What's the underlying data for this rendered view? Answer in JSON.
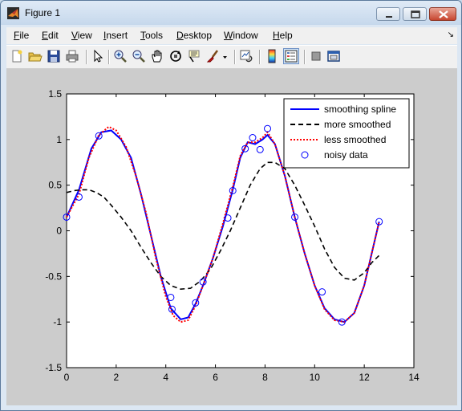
{
  "window": {
    "title": "Figure 1"
  },
  "menu": {
    "items": [
      {
        "pre": "",
        "key": "F",
        "rest": "ile"
      },
      {
        "pre": "",
        "key": "E",
        "rest": "dit"
      },
      {
        "pre": "",
        "key": "V",
        "rest": "iew"
      },
      {
        "pre": "",
        "key": "I",
        "rest": "nsert"
      },
      {
        "pre": "",
        "key": "T",
        "rest": "ools"
      },
      {
        "pre": "",
        "key": "D",
        "rest": "esktop"
      },
      {
        "pre": "",
        "key": "W",
        "rest": "indow"
      },
      {
        "pre": "",
        "key": "H",
        "rest": "elp"
      }
    ]
  },
  "toolbar": {
    "icons": [
      "new-figure-icon",
      "open-file-icon",
      "save-icon",
      "print-icon",
      "edit-plot-icon",
      "zoom-in-icon",
      "zoom-out-icon",
      "pan-icon",
      "rotate-3d-icon",
      "data-cursor-icon",
      "brush-icon",
      "brush-dropdown-icon",
      "link-plot-icon",
      "insert-colorbar-icon",
      "insert-legend-icon",
      "hide-plot-tools-icon",
      "show-plot-tools-icon"
    ]
  },
  "chart_data": {
    "type": "line",
    "title": "",
    "xlabel": "",
    "ylabel": "",
    "xlim": [
      0,
      14
    ],
    "ylim": [
      -1.5,
      1.5
    ],
    "xticks": [
      "0",
      "2",
      "4",
      "6",
      "8",
      "10",
      "12",
      "14"
    ],
    "yticks": [
      "-1.5",
      "-1",
      "-0.5",
      "0",
      "0.5",
      "1",
      "1.5"
    ],
    "grid": false,
    "legend_position": "top-right",
    "series": [
      {
        "name": "smoothing spline",
        "style": "solid",
        "color": "#0000ff",
        "x": [
          0,
          0.5,
          1,
          1.4,
          1.8,
          2.2,
          2.6,
          3.0,
          3.4,
          3.8,
          4.2,
          4.6,
          4.9,
          5.2,
          5.5,
          5.9,
          6.3,
          6.7,
          7.0,
          7.3,
          7.6,
          7.9,
          8.1,
          8.4,
          8.8,
          9.2,
          9.6,
          10.0,
          10.4,
          10.8,
          11.2,
          11.6,
          12.0,
          12.3,
          12.6
        ],
        "y": [
          0.15,
          0.45,
          0.9,
          1.08,
          1.1,
          1.0,
          0.8,
          0.4,
          -0.05,
          -0.5,
          -0.85,
          -0.97,
          -0.95,
          -0.8,
          -0.6,
          -0.3,
          0.05,
          0.45,
          0.8,
          0.97,
          0.95,
          1.0,
          1.05,
          0.95,
          0.6,
          0.15,
          -0.25,
          -0.6,
          -0.85,
          -0.97,
          -1.0,
          -0.9,
          -0.6,
          -0.25,
          0.1
        ]
      },
      {
        "name": "more smoothed",
        "style": "dashed",
        "color": "#000000",
        "x": [
          0,
          0.3,
          0.6,
          0.9,
          1.2,
          1.5,
          1.8,
          2.2,
          2.6,
          3.0,
          3.4,
          3.8,
          4.2,
          4.6,
          5.0,
          5.4,
          5.8,
          6.2,
          6.6,
          7.0,
          7.4,
          7.8,
          8.1,
          8.4,
          8.8,
          9.2,
          9.6,
          10.0,
          10.4,
          10.8,
          11.2,
          11.6,
          12.0,
          12.3,
          12.6
        ],
        "y": [
          0.42,
          0.44,
          0.45,
          0.45,
          0.42,
          0.37,
          0.28,
          0.15,
          0.0,
          -0.18,
          -0.35,
          -0.5,
          -0.6,
          -0.64,
          -0.63,
          -0.55,
          -0.42,
          -0.22,
          0.0,
          0.25,
          0.5,
          0.68,
          0.75,
          0.75,
          0.68,
          0.5,
          0.28,
          0.05,
          -0.2,
          -0.4,
          -0.52,
          -0.54,
          -0.46,
          -0.35,
          -0.27
        ]
      },
      {
        "name": "less smoothed",
        "style": "dotted",
        "color": "#ff0000",
        "x": [
          0,
          0.5,
          0.9,
          1.3,
          1.7,
          2.0,
          2.4,
          2.8,
          3.2,
          3.6,
          4.0,
          4.3,
          4.6,
          4.9,
          5.2,
          5.5,
          5.9,
          6.3,
          6.7,
          7.0,
          7.3,
          7.6,
          7.9,
          8.1,
          8.4,
          8.8,
          9.2,
          9.6,
          10.0,
          10.4,
          10.8,
          11.2,
          11.6,
          12.0,
          12.3,
          12.6
        ],
        "y": [
          0.15,
          0.4,
          0.8,
          1.05,
          1.14,
          1.1,
          0.92,
          0.6,
          0.2,
          -0.3,
          -0.72,
          -0.93,
          -1.0,
          -0.98,
          -0.82,
          -0.6,
          -0.3,
          0.08,
          0.48,
          0.82,
          0.97,
          0.97,
          1.02,
          1.08,
          0.95,
          0.6,
          0.15,
          -0.25,
          -0.6,
          -0.86,
          -0.98,
          -1.0,
          -0.9,
          -0.6,
          -0.25,
          0.1
        ]
      },
      {
        "name": "noisy data",
        "style": "marker-circle",
        "color": "#0000ff",
        "x": [
          0,
          0.5,
          1.3,
          4.2,
          4.25,
          5.2,
          5.5,
          6.5,
          6.7,
          7.2,
          7.5,
          7.8,
          8.1,
          9.2,
          10.3,
          11.1,
          12.6
        ],
        "y": [
          0.15,
          0.37,
          1.04,
          -0.73,
          -0.86,
          -0.79,
          -0.56,
          0.14,
          0.44,
          0.9,
          1.02,
          0.89,
          1.12,
          0.15,
          -0.67,
          -1.0,
          0.1
        ]
      }
    ]
  }
}
